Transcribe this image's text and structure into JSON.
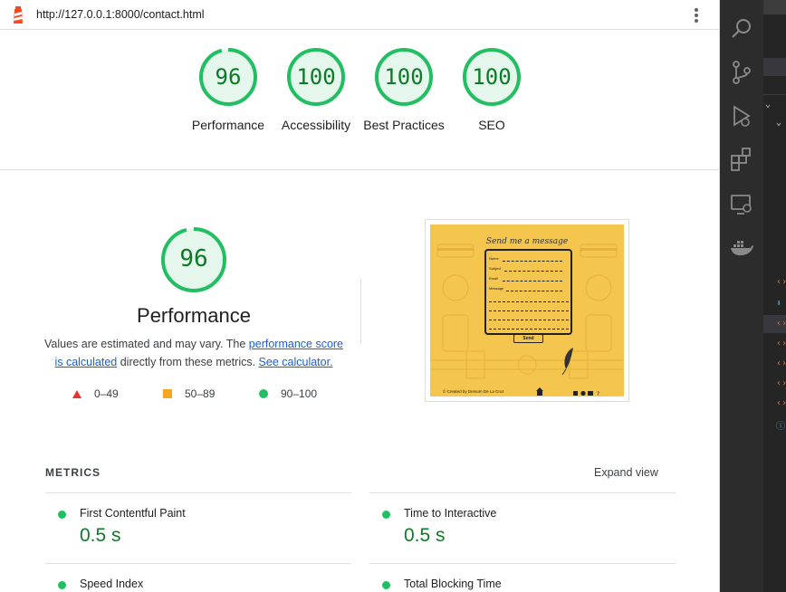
{
  "urlbar": {
    "url": "http://127.0.0.1:8000/contact.html"
  },
  "scores": [
    {
      "label": "Performance",
      "value": "96",
      "fraction": 0.96
    },
    {
      "label": "Accessibility",
      "value": "100",
      "fraction": 1.0
    },
    {
      "label": "Best Practices",
      "value": "100",
      "fraction": 1.0
    },
    {
      "label": "SEO",
      "value": "100",
      "fraction": 1.0
    }
  ],
  "performance": {
    "score": "96",
    "fraction": 0.96,
    "title": "Performance",
    "desc_pre": "Values are estimated and may vary. The ",
    "link1": "performance score is calculated",
    "desc_mid": " directly from these metrics. ",
    "link2": "See calculator."
  },
  "legend": [
    {
      "range": "0–49",
      "shape": "triangle",
      "color": "#e8332c"
    },
    {
      "range": "50–89",
      "shape": "square",
      "color": "#f5a623"
    },
    {
      "range": "90–100",
      "shape": "circle",
      "color": "#21bf62"
    }
  ],
  "screenshot": {
    "heading": "Send me a message",
    "fields": [
      "Name",
      "Subject",
      "Email",
      "Message"
    ],
    "send": "Send",
    "footer_credit": "© Created by Dersom De La Cruz"
  },
  "metrics": {
    "heading": "METRICS",
    "expand": "Expand view",
    "items": [
      {
        "name": "First Contentful Paint",
        "value": "0.5 s"
      },
      {
        "name": "Time to Interactive",
        "value": "0.5 s"
      },
      {
        "name": "Speed Index",
        "value": ""
      },
      {
        "name": "Total Blocking Time",
        "value": ""
      }
    ]
  },
  "colors": {
    "pass": "#0c7a27",
    "pass_ring": "#21bf62",
    "pass_bg": "#e5f6ec",
    "link": "#1a5fd9"
  },
  "activity_bar": [
    "search-icon",
    "source-control-icon",
    "run-debug-icon",
    "extensions-icon",
    "remote-explorer-icon",
    "docker-icon"
  ]
}
